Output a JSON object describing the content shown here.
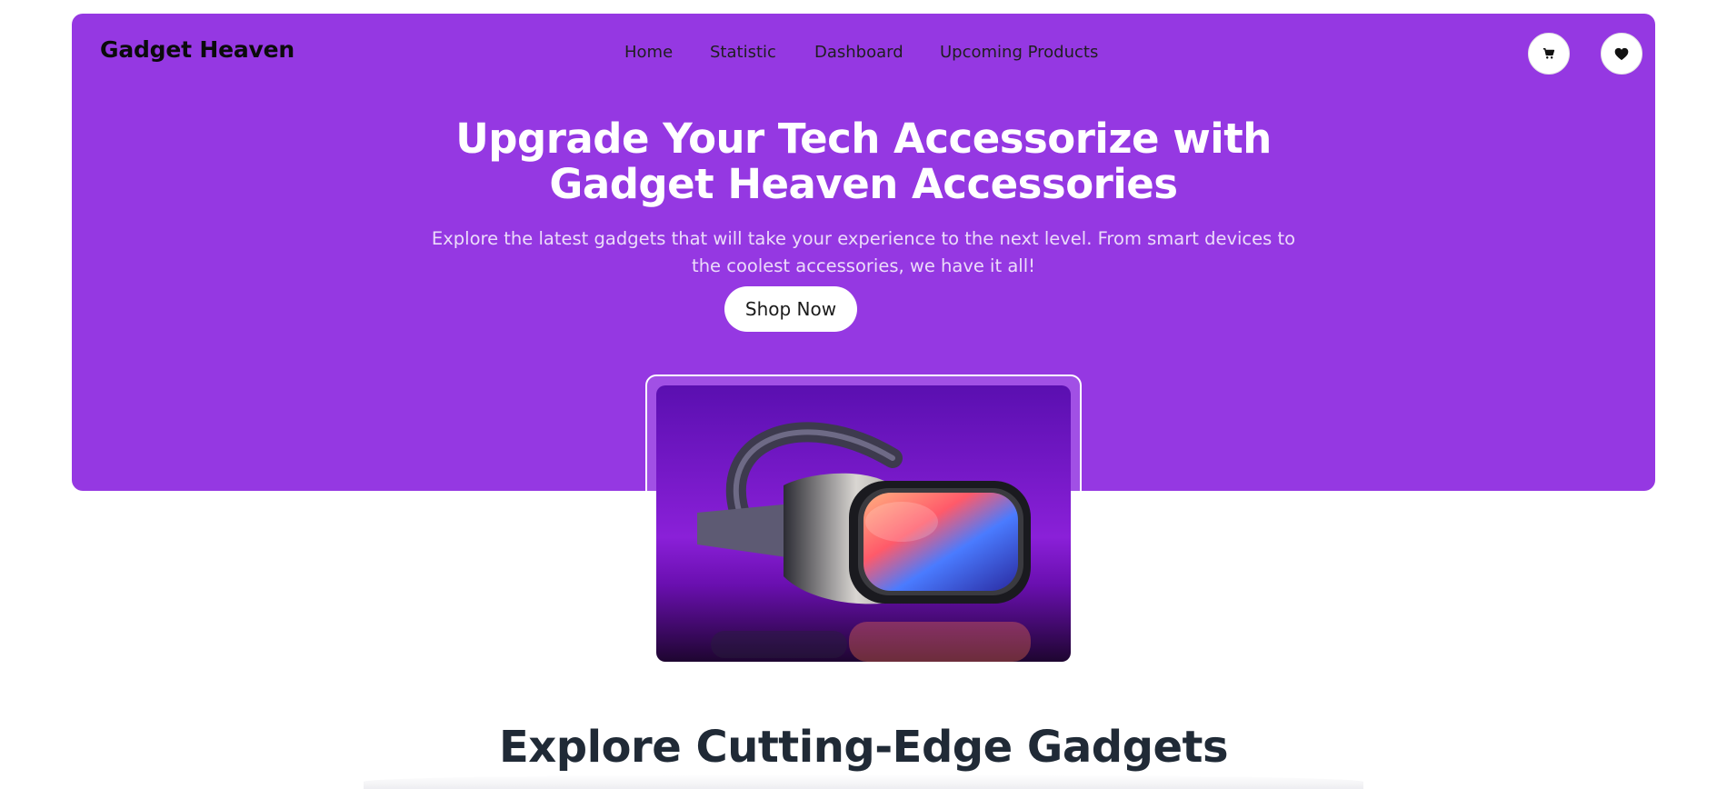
{
  "header": {
    "logo": "Gadget Heaven",
    "nav": [
      {
        "label": "Home"
      },
      {
        "label": "Statistic"
      },
      {
        "label": "Dashboard"
      },
      {
        "label": "Upcoming Products"
      }
    ],
    "icons": {
      "cart": "cart-icon",
      "wishlist": "heart-icon"
    }
  },
  "hero": {
    "headline_line1": "Upgrade Your Tech Accessorize with",
    "headline_line2": "Gadget Heaven Accessories",
    "subtext_line1": "Explore the latest gadgets that will take your experience to the next level. From smart devices to",
    "subtext_line2": "the coolest accessories, we have it all!",
    "cta_label": "Shop Now",
    "banner_image": "vr-headset-image"
  },
  "section": {
    "title": "Explore Cutting-Edge Gadgets"
  },
  "colors": {
    "brand": "#9538e2",
    "hero_text": "#ffffff",
    "heading_dark": "#202a36"
  }
}
